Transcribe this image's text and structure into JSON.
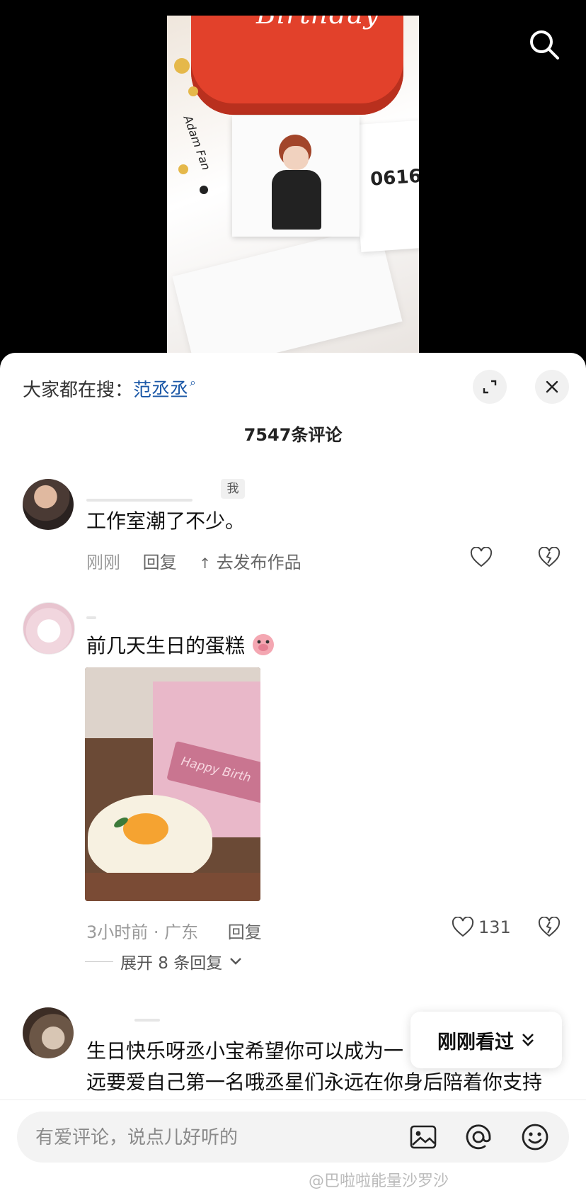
{
  "video": {
    "cake_text": "Birthday",
    "side_card_text": "0616",
    "side_script": "Adam Fan"
  },
  "sheet": {
    "hot_search_prefix": "大家都在搜：",
    "hot_search_keyword": "范丞丞",
    "comment_count": "7547条评论"
  },
  "comments": [
    {
      "badge": "我",
      "text": "工作室潮了不少。",
      "time": "刚刚",
      "reply_label": "回复",
      "publish_label": "去发布作品"
    },
    {
      "text": "前几天生日的蛋糕",
      "emoji": "pig-emoji",
      "image": {
        "topper_text": "Happy Birth"
      },
      "time_location": "3小时前 · 广东",
      "reply_label": "回复",
      "likes": "131",
      "expand_label": "展开 8 条回复"
    },
    {
      "text_line1": "生日快乐呀丞小宝希望你可以成为一",
      "text_line2": "远要爱自己第一名哦丞星们永远在你身后陪着你支持"
    }
  ],
  "floating": {
    "recently_viewed": "刚刚看过"
  },
  "input": {
    "placeholder": "有爱评论，说点儿好听的"
  },
  "watermark": "@巴啦啦能量沙罗沙"
}
